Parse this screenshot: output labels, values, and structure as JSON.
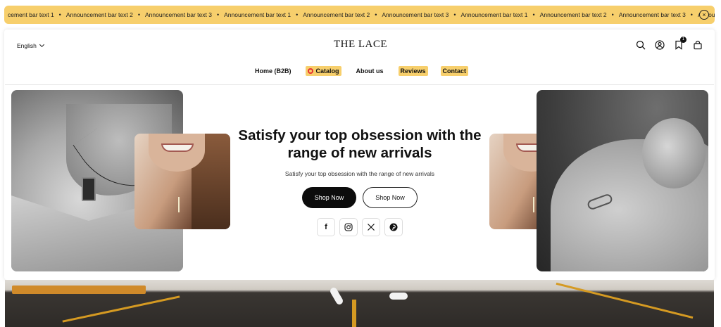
{
  "announcement": {
    "items": [
      "cement bar text 1",
      "Announcement bar text 2",
      "Announcement bar text 3",
      "Announcement bar text 1",
      "Announcement bar text 2",
      "Announcement bar text 3",
      "Announcement bar text 1",
      "Announcement bar text 2",
      "Announcement bar text 3",
      "Announcem"
    ],
    "separator": "•",
    "close_icon": "close-circle-icon",
    "close_glyph": "×",
    "background": "#f7cf6c"
  },
  "header": {
    "language": "English",
    "logo": "THE LACE",
    "icons": [
      "search-icon",
      "account-icon",
      "wishlist-icon",
      "cart-icon"
    ],
    "wishlist_count": "1"
  },
  "nav": {
    "items": [
      {
        "label": "Home (B2B)",
        "highlight": false
      },
      {
        "label": "Catalog",
        "highlight": true,
        "icon": "catalog-badge-icon"
      },
      {
        "label": "About us",
        "highlight": false
      },
      {
        "label": "Reviews",
        "highlight": true
      },
      {
        "label": "Contact",
        "highlight": true
      }
    ],
    "highlight_color": "#f7cf6c"
  },
  "hero": {
    "title": "Satisfy your top obsession with the range of new arrivals",
    "subtitle": "Satisfy your top obsession with the range of new arrivals",
    "primary_button": "Shop Now",
    "secondary_button": "Shop Now",
    "social": [
      "facebook-icon",
      "instagram-icon",
      "x-icon",
      "pinterest-icon"
    ],
    "social_glyphs": {
      "facebook": "f",
      "x": "𝕏"
    }
  }
}
